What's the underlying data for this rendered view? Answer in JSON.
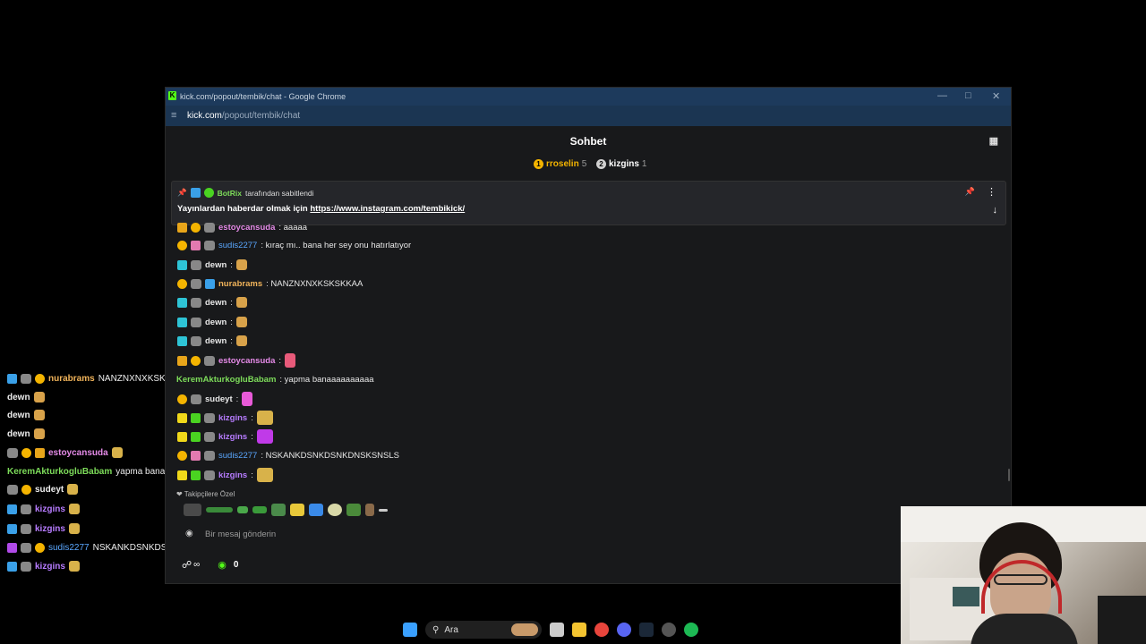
{
  "window": {
    "title": "kick.com/popout/tembik/chat - Google Chrome",
    "url_domain": "kick.com",
    "url_path": "/popout/tembik/chat"
  },
  "chat": {
    "title": "Sohbet",
    "leaderboard": [
      {
        "rank": "1",
        "name": "rroselin",
        "count": "5",
        "color": "#f4b400"
      },
      {
        "rank": "2",
        "name": "kizgins",
        "count": "1",
        "color": "#d0d0d0"
      }
    ],
    "pinned": {
      "by_user": "BotRix",
      "by_suffix": "tarafından sabitlendi",
      "text": "Yayınlardan haberdar olmak için ",
      "link": "https://www.instagram.com/tembikick/"
    },
    "messages": [
      {
        "user": "estoycansuda",
        "color": "#e58be8",
        "text": ": aaaaa"
      },
      {
        "user": "sudis2277",
        "color": "#5aa7ff",
        "text": ": kıraç mı.. bana her sey onu hatırlatıyor"
      },
      {
        "user": "dewn",
        "color": "#ffffff",
        "text": ":"
      },
      {
        "user": "nurabrams",
        "color": "#f0b35a",
        "text": ": NANZNXNXKSKSKKAA"
      },
      {
        "user": "dewn",
        "color": "#ffffff",
        "text": ":"
      },
      {
        "user": "dewn",
        "color": "#ffffff",
        "text": ":"
      },
      {
        "user": "dewn",
        "color": "#ffffff",
        "text": ":"
      },
      {
        "user": "estoycansuda",
        "color": "#e58be8",
        "text": ":"
      },
      {
        "user": "KeremAkturkogluBabam",
        "color": "#7ddc5a",
        "text": ": yapma banaaaaaaaaaa"
      },
      {
        "user": "sudeyt",
        "color": "#ffffff",
        "text": ":"
      },
      {
        "user": "kizgins",
        "color": "#b77cff",
        "text": ":"
      },
      {
        "user": "kizgins",
        "color": "#b77cff",
        "text": ":"
      },
      {
        "user": "sudis2277",
        "color": "#5aa7ff",
        "text": ": NSKANKDSNKDSNKDNSKSNSLS"
      },
      {
        "user": "kizgins",
        "color": "#b77cff",
        "text": ":"
      }
    ],
    "followers_label": "Takipçilere Özel",
    "input_placeholder": "Bir mesaj gönderin",
    "infinity": "∞",
    "points": "0"
  },
  "overlay": [
    {
      "user": "nurabrams",
      "color": "#f0b35a",
      "text": "NANZNXNXKSKSKKAA"
    },
    {
      "user": "dewn",
      "color": "#ffffff",
      "text": ""
    },
    {
      "user": "dewn",
      "color": "#ffffff",
      "text": ""
    },
    {
      "user": "dewn",
      "color": "#ffffff",
      "text": ""
    },
    {
      "user": "estoycansuda",
      "color": "#e58be8",
      "text": ""
    },
    {
      "user": "KeremAkturkogluBabam",
      "color": "#7ddc5a",
      "text": "yapma banaaaaaaaaaa"
    },
    {
      "user": "sudeyt",
      "color": "#ffffff",
      "text": ""
    },
    {
      "user": "kizgins",
      "color": "#b77cff",
      "text": ""
    },
    {
      "user": "kizgins",
      "color": "#b77cff",
      "text": ""
    },
    {
      "user": "sudis2277",
      "color": "#5aa7ff",
      "text": "NSKANKDSNKDSNKDNSKSNSLS"
    },
    {
      "user": "kizgins",
      "color": "#b77cff",
      "text": ""
    }
  ],
  "taskbar": {
    "search_label": "Ara"
  }
}
